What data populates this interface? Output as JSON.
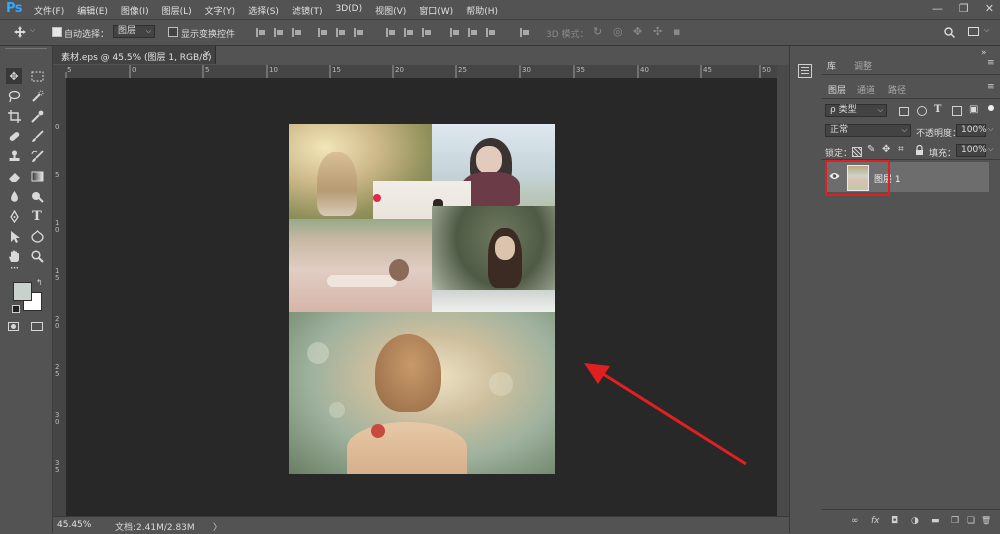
{
  "app": {
    "logo": "Ps"
  },
  "menu": [
    "文件(F)",
    "编辑(E)",
    "图像(I)",
    "图层(L)",
    "文字(Y)",
    "选择(S)",
    "滤镜(T)",
    "3D(D)",
    "视图(V)",
    "窗口(W)",
    "帮助(H)"
  ],
  "window_controls": {
    "minimize": "—",
    "restore": "❐",
    "close": "✕"
  },
  "options": {
    "auto_select_label": "自动选择：",
    "auto_select_value": "图层",
    "show_transform_label": "显示变换控件",
    "mode_3d_label": "3D 模式："
  },
  "document": {
    "tab_title": "素材.eps @ 45.5% (图层 1, RGB/8)",
    "tab_close": "×",
    "zoom": "45.45%",
    "doc_size": "文档:2.41M/2.83M",
    "status_arrow": "〉"
  },
  "ruler": {
    "top": [
      "5",
      "0",
      "5",
      "10",
      "15",
      "20",
      "25",
      "30",
      "35",
      "40",
      "45",
      "50"
    ],
    "left": [
      "0",
      "5",
      "1\n0",
      "1\n5",
      "2\n0",
      "2\n5",
      "3\n0",
      "3\n5"
    ]
  },
  "panels": {
    "top_tabs": [
      "库",
      "调整"
    ],
    "layer_tabs": [
      "图层",
      "通道",
      "路径"
    ],
    "filter_kind": "ρ 类型",
    "blend_mode": "正常",
    "opacity_label": "不透明度：",
    "opacity_value": "100%",
    "lock_label": "锁定：",
    "fill_label": "填充：",
    "fill_value": "100%",
    "layer_name": "图层 1",
    "bottom_icons": [
      "∞",
      "fx",
      "◘",
      "◑",
      "▬",
      "❒",
      "❏",
      "🗑"
    ]
  },
  "colors": {
    "foreground": "#c8d1cc",
    "background": "#ffffff",
    "annotation": "#e02020"
  }
}
